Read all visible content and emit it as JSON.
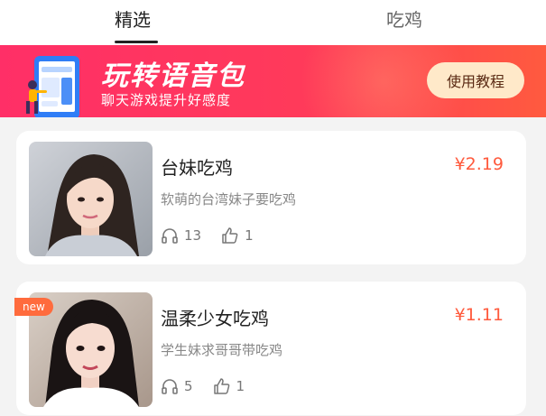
{
  "tabs": [
    {
      "label": "精选",
      "active": true
    },
    {
      "label": "吃鸡",
      "active": false
    }
  ],
  "banner": {
    "title": "玩转语音包",
    "subtitle": "聊天游戏提升好感度",
    "button_label": "使用教程",
    "colors": {
      "start": "#ff2f67",
      "end": "#ff5a3f",
      "button": "#ffe9c9"
    }
  },
  "items": [
    {
      "title": "台妹吃鸡",
      "price": "¥2.19",
      "desc": "软萌的台湾妹子要吃鸡",
      "listens": "13",
      "likes": "1",
      "is_new": false
    },
    {
      "title": "温柔少女吃鸡",
      "price": "¥1.11",
      "desc": "学生妹求哥哥带吃鸡",
      "listens": "5",
      "likes": "1",
      "is_new": true,
      "badge": "new"
    }
  ],
  "icons": {
    "listen": "headphones-icon",
    "like": "thumbs-up-icon"
  },
  "accent_color": "#ff5a3d"
}
